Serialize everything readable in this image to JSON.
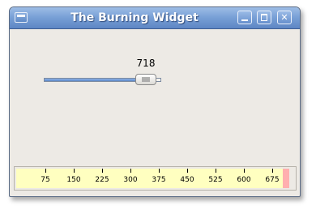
{
  "window": {
    "title": "The Burning Widget"
  },
  "slider": {
    "value": 718,
    "value_label": "718",
    "min": 0,
    "max": 750
  },
  "burning_widget": {
    "max": 750,
    "capacity": 700,
    "value": 718,
    "ticks": [
      "75",
      "150",
      "225",
      "300",
      "375",
      "450",
      "525",
      "600",
      "675"
    ],
    "colors": {
      "normal": "#ffffc0",
      "over_capacity": "#ffafaf"
    }
  }
}
